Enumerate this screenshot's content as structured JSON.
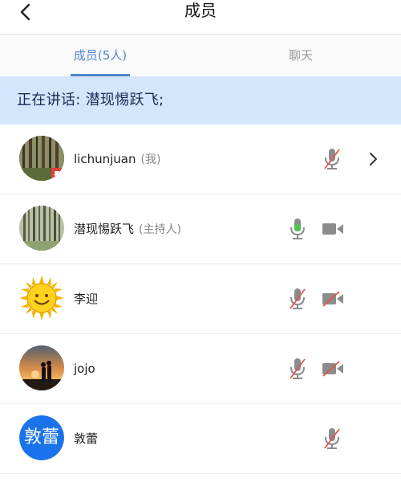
{
  "header": {
    "title": "成员"
  },
  "tabs": [
    {
      "label": "成员(5人)",
      "active": true
    },
    {
      "label": "聊天",
      "active": false
    }
  ],
  "speaking": {
    "text": "正在讲话: 潜现惕跃飞;"
  },
  "members": [
    {
      "name": "lichunjuan",
      "role": "(我)",
      "mic": "muted",
      "camera": "none",
      "chevron": true
    },
    {
      "name": "潜现惕跃飞",
      "role": "(主持人)",
      "mic": "active",
      "camera": "on",
      "chevron": false
    },
    {
      "name": "李迎",
      "role": "",
      "mic": "muted",
      "camera": "off",
      "chevron": false
    },
    {
      "name": "jojo",
      "role": "",
      "mic": "muted",
      "camera": "off",
      "chevron": false
    },
    {
      "name": "敦蕾",
      "role": "",
      "mic": "muted",
      "camera": "none",
      "chevron": false,
      "avatar_text": "敦蕾"
    }
  ],
  "colors": {
    "accent": "#4f86c9",
    "speaking_bg": "#d4e6fb",
    "mic_active": "#4cc24f",
    "muted_slash": "#e0564d",
    "icon_gray": "#8c8c8c",
    "text_avatar_bg": "#1a73ea"
  }
}
